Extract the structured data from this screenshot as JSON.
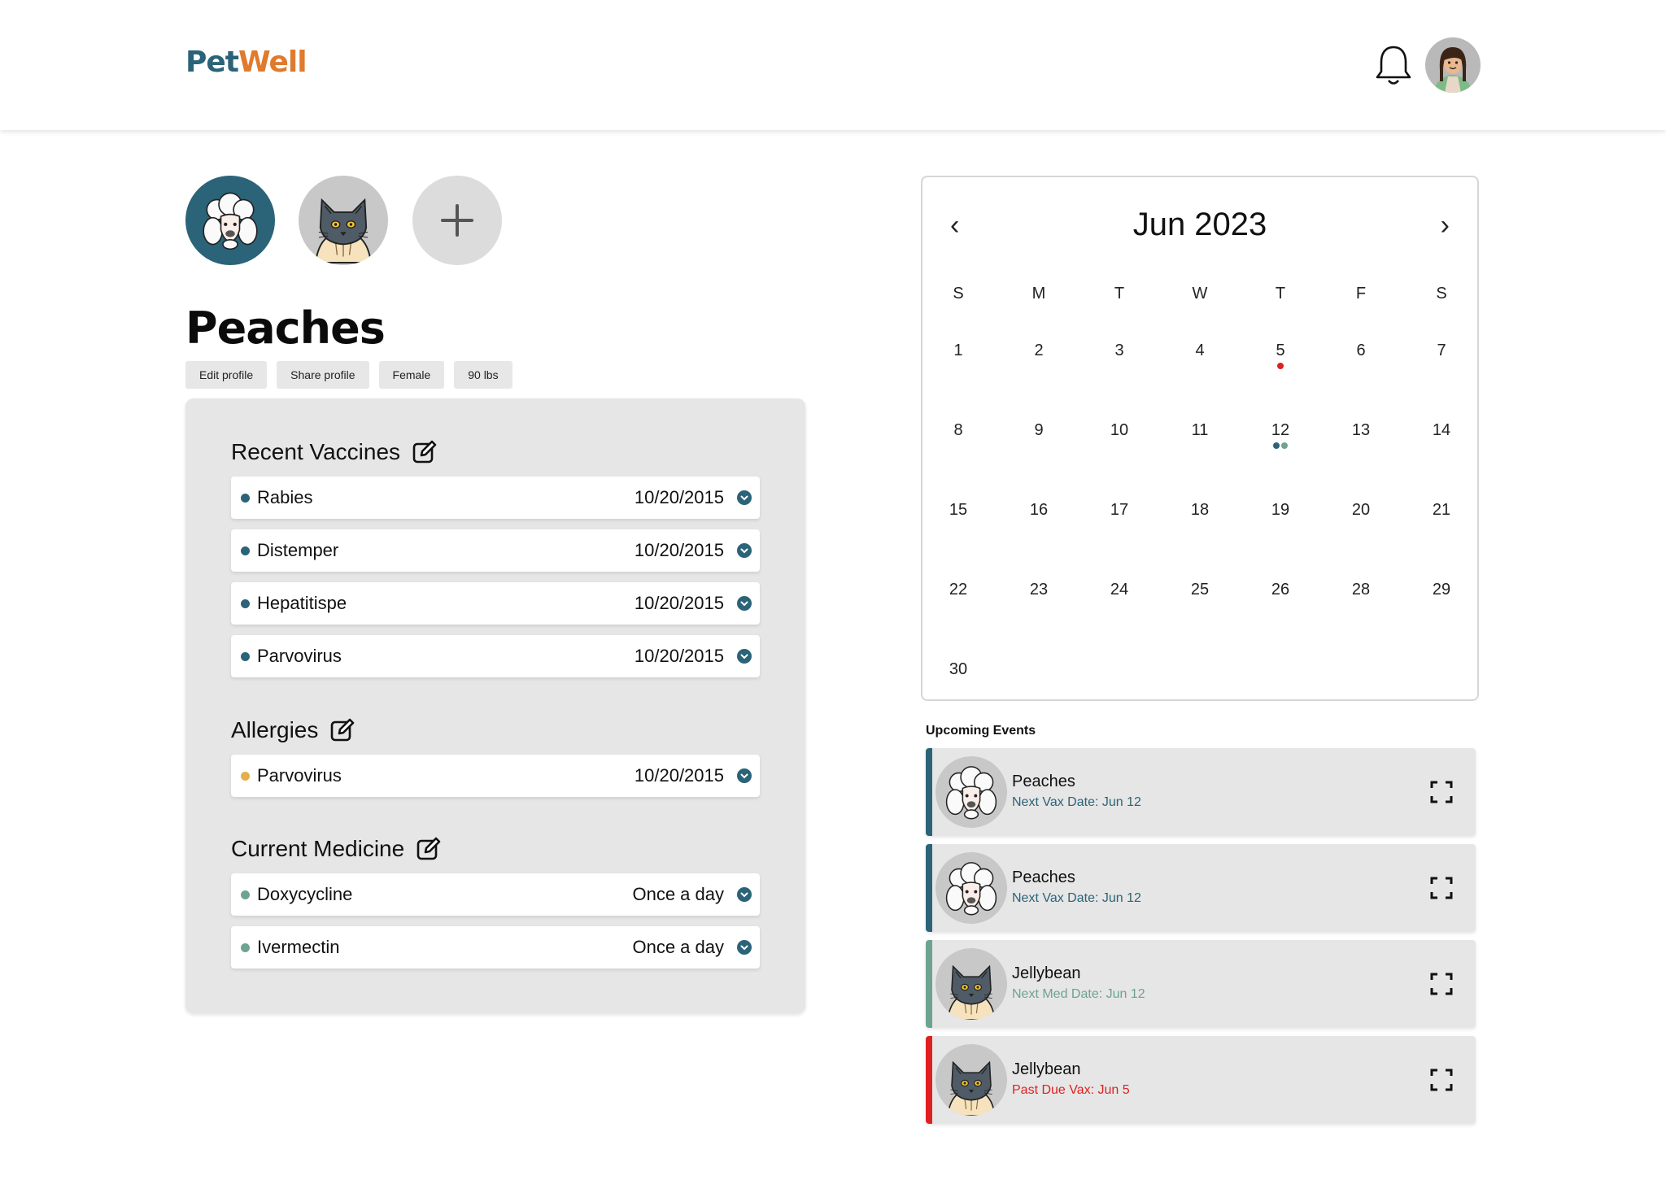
{
  "colors": {
    "brand_teal": "#2b6378",
    "brand_orange": "#e07a2d",
    "alert_red": "#e02020",
    "sage": "#6ea293",
    "amber": "#e0b04a"
  },
  "header": {
    "logo_part1": "Pet",
    "logo_part2": "Well",
    "icons": [
      "bell-icon",
      "user-avatar"
    ]
  },
  "pets": [
    {
      "name": "Peaches",
      "icon": "poodle-icon",
      "selected": true
    },
    {
      "name": "Jellybean",
      "icon": "cat-icon",
      "selected": false
    }
  ],
  "add_pet_icon": "plus-icon",
  "profile": {
    "name": "Peaches",
    "chips": {
      "edit": "Edit profile",
      "share": "Share profile",
      "sex": "Female",
      "weight": "90 lbs"
    }
  },
  "vaccines": {
    "title": "Recent Vaccines",
    "items": [
      {
        "label": "Rabies",
        "value": "10/20/2015"
      },
      {
        "label": "Distemper",
        "value": "10/20/2015"
      },
      {
        "label": "Hepatitispe",
        "value": "10/20/2015"
      },
      {
        "label": "Parvovirus",
        "value": "10/20/2015"
      }
    ]
  },
  "allergies": {
    "title": "Allergies",
    "items": [
      {
        "label": "Parvovirus",
        "value": "10/20/2015"
      }
    ]
  },
  "medicine": {
    "title": "Current Medicine",
    "items": [
      {
        "label": "Doxycycline",
        "value": "Once a day"
      },
      {
        "label": "Ivermectin",
        "value": "Once a day"
      }
    ]
  },
  "calendar": {
    "title": "Jun 2023",
    "prev": "‹",
    "next": "›",
    "weekdays": [
      "S",
      "M",
      "T",
      "W",
      "T",
      "F",
      "S"
    ],
    "weeks": [
      [
        "1",
        "2",
        "3",
        "4",
        "5",
        "6",
        "7"
      ],
      [
        "8",
        "9",
        "10",
        "11",
        "12",
        "13",
        "14"
      ],
      [
        "15",
        "16",
        "17",
        "18",
        "19",
        "20",
        "21"
      ],
      [
        "22",
        "23",
        "24",
        "25",
        "26",
        "28",
        "29"
      ],
      [
        "30"
      ]
    ]
  },
  "upcoming": {
    "title": "Upcoming Events",
    "events": [
      {
        "name": "Peaches",
        "detail": "Next Vax Date: Jun 12",
        "pet": "poodle"
      },
      {
        "name": "Peaches",
        "detail": "Next Vax Date: Jun 12",
        "pet": "poodle"
      },
      {
        "name": "Jellybean",
        "detail": "Next Med Date: Jun 12",
        "pet": "cat"
      },
      {
        "name": "Jellybean",
        "detail": "Past Due Vax: Jun 5",
        "pet": "cat"
      }
    ]
  }
}
